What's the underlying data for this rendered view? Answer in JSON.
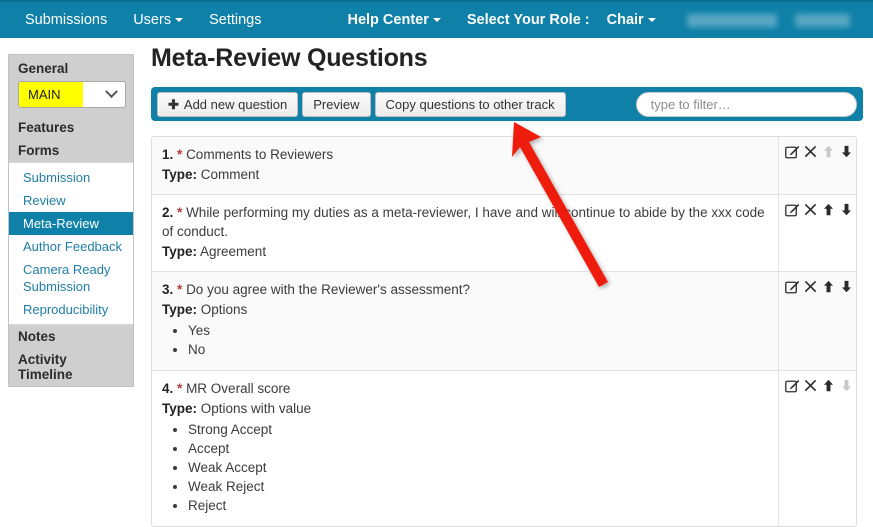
{
  "navbar": {
    "left_items": [
      {
        "label": "Submissions",
        "name": "nav-submissions",
        "caret": false,
        "bold": false
      },
      {
        "label": "Users",
        "name": "nav-users",
        "caret": true,
        "bold": false
      },
      {
        "label": "Settings",
        "name": "nav-settings",
        "caret": false,
        "bold": false
      }
    ],
    "help_center": "Help Center",
    "role_label": "Select Your Role :",
    "role_value": "Chair",
    "background_color": "#0f81a8",
    "redacted_blocks": 2
  },
  "sidebar": {
    "general_header": "General",
    "track_select": {
      "value": "MAIN",
      "highlight_color": "#ffff00"
    },
    "features_label": "Features",
    "forms_label": "Forms",
    "form_links": [
      {
        "label": "Submission",
        "active": false
      },
      {
        "label": "Review",
        "active": false
      },
      {
        "label": "Meta-Review",
        "active": true
      },
      {
        "label": "Author Feedback",
        "active": false
      },
      {
        "label": "Camera Ready Submission",
        "active": false
      },
      {
        "label": "Reproducibility",
        "active": false
      }
    ],
    "notes_label": "Notes",
    "activity_timeline_label": "Activity Timeline",
    "active_color": "#0f81a8",
    "link_color": "#1f7ea8"
  },
  "main": {
    "page_title": "Meta-Review Questions",
    "toolbar": {
      "add_question_label": "Add new question",
      "add_question_icon": "plus-icon",
      "preview_label": "Preview",
      "copy_questions_label": "Copy questions to other track",
      "filter_placeholder": "type to filter…",
      "filter_value": ""
    },
    "questions": [
      {
        "number": "1.",
        "required_marker": "*",
        "title": "Comments to Reviewers",
        "type_label": "Type:",
        "type_value": "Comment",
        "options": [],
        "actions": {
          "edit": true,
          "delete": true,
          "move_up": false,
          "move_down": true
        }
      },
      {
        "number": "2.",
        "required_marker": "*",
        "title": "While performing my duties as a meta-reviewer, I have and will continue to abide by the xxx code of conduct.",
        "type_label": "Type:",
        "type_value": "Agreement",
        "options": [],
        "actions": {
          "edit": true,
          "delete": true,
          "move_up": true,
          "move_down": true
        }
      },
      {
        "number": "3.",
        "required_marker": "*",
        "title": "Do you agree with the Reviewer's assessment?",
        "type_label": "Type:",
        "type_value": "Options",
        "options": [
          "Yes",
          "No"
        ],
        "actions": {
          "edit": true,
          "delete": true,
          "move_up": true,
          "move_down": true
        }
      },
      {
        "number": "4.",
        "required_marker": "*",
        "title": "MR Overall score",
        "type_label": "Type:",
        "type_value": "Options with value",
        "options": [
          "Strong Accept",
          "Accept",
          "Weak Accept",
          "Weak Reject",
          "Reject"
        ],
        "actions": {
          "edit": true,
          "delete": true,
          "move_up": true,
          "move_down": false
        }
      }
    ],
    "action_icon_names": [
      "edit-icon",
      "delete-icon",
      "move-up-icon",
      "move-down-icon"
    ]
  },
  "annotation": {
    "arrow_color": "#ee1c11",
    "points_to": "Copy questions to other track"
  }
}
